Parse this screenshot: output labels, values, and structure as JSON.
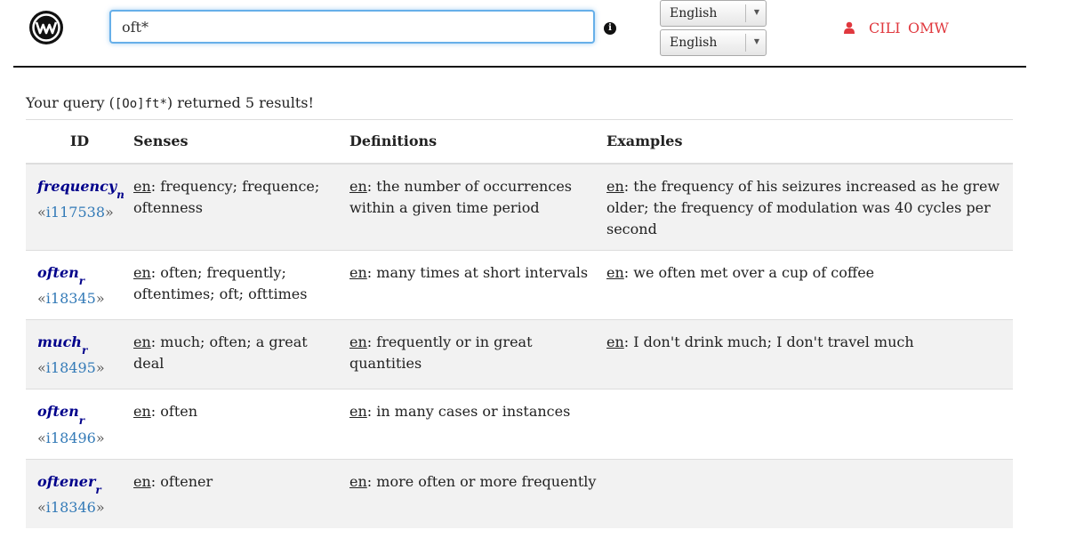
{
  "search": {
    "value": "oft*"
  },
  "language_selects": [
    "English",
    "English"
  ],
  "nav": {
    "cili": "CILI",
    "omw": "OMW"
  },
  "summary": {
    "prefix": "Your query (",
    "query": "[Oo]ft*",
    "suffix": ") returned 5 results!"
  },
  "table": {
    "headers": [
      "ID",
      "Senses",
      "Definitions",
      "Examples"
    ],
    "rows": [
      {
        "lemma": "frequency",
        "pos": "n",
        "ili": "i117538",
        "senses_lang": "en",
        "senses": "frequency; frequence; oftenness",
        "def_lang": "en",
        "definition": "the number of occurrences within a given time period",
        "ex_lang": "en",
        "example": "the frequency of his seizures increased as he grew older; the frequency of modulation was 40 cycles per second"
      },
      {
        "lemma": "often",
        "pos": "r",
        "ili": "i18345",
        "senses_lang": "en",
        "senses": "often; frequently; oftentimes; oft; ofttimes",
        "def_lang": "en",
        "definition": "many times at short intervals",
        "ex_lang": "en",
        "example": "we often met over a cup of coffee"
      },
      {
        "lemma": "much",
        "pos": "r",
        "ili": "i18495",
        "senses_lang": "en",
        "senses": "much; often; a great deal",
        "def_lang": "en",
        "definition": "frequently or in great quantities",
        "ex_lang": "en",
        "example": "I don't drink much; I don't travel much"
      },
      {
        "lemma": "often",
        "pos": "r",
        "ili": "i18496",
        "senses_lang": "en",
        "senses": "often",
        "def_lang": "en",
        "definition": "in many cases or instances",
        "ex_lang": "",
        "example": ""
      },
      {
        "lemma": "oftener",
        "pos": "r",
        "ili": "i18346",
        "senses_lang": "en",
        "senses": "oftener",
        "def_lang": "en",
        "definition": "more often or more frequently",
        "ex_lang": "",
        "example": ""
      }
    ]
  }
}
